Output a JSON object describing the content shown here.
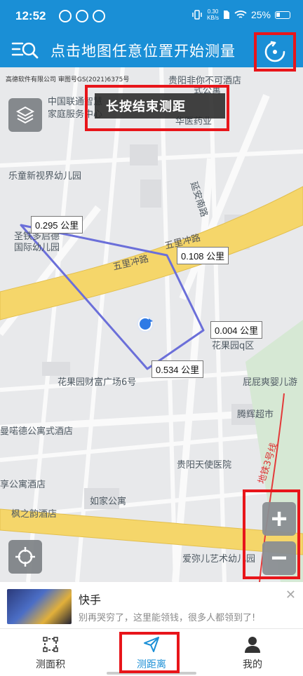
{
  "status_bar": {
    "time": "12:52",
    "net_speed_value": "0.30",
    "net_speed_unit": "KB/s",
    "battery": "25%"
  },
  "header": {
    "title": "点击地图任意位置开始测量",
    "menu_icon": "menu-search-icon",
    "reset_icon": "reset-icon"
  },
  "map": {
    "copyright": "高德软件有限公司 审图号GS(2021)6375号",
    "hint": "长按结束测距",
    "labels": [
      "贵阳非你不可酒店",
      "中国联通智慧",
      "家庭服务中心",
      "式公寓",
      "华医药业",
      "乐童新视界幼儿园",
      "延安南路",
      "圣铁多启德",
      "国际幼儿园",
      "五里冲路",
      "五里冲路",
      "花果园q区",
      "花果园财富广场6号",
      "屁屁爽婴儿游",
      "腾辉超市",
      "曼喏德公寓式酒店",
      "贵阳天使医院",
      "地铁3号线",
      "享公寓酒店",
      "如家公寓",
      "枫之韵酒店",
      "爱弥儿艺术幼儿园"
    ],
    "measurements": [
      {
        "text": "0.295 公里"
      },
      {
        "text": "0.108 公里"
      },
      {
        "text": "0.004 公里"
      },
      {
        "text": "0.534 公里"
      }
    ],
    "zoom_in_label": "+",
    "zoom_out_label": "−"
  },
  "ad": {
    "title": "快手",
    "description": "别再哭穷了，这里能领钱，很多人都领到了!",
    "close": "✕"
  },
  "bottom_nav": {
    "items": [
      {
        "label": "测面积",
        "icon": "area-icon"
      },
      {
        "label": "测距离",
        "icon": "distance-icon",
        "active": true
      },
      {
        "label": "我的",
        "icon": "user-icon"
      }
    ]
  },
  "colors": {
    "primary": "#1a8fd6",
    "highlight_box": "#e8151a",
    "measure_line": "#6b6fd9",
    "road_yellow": "#f5d66a"
  }
}
